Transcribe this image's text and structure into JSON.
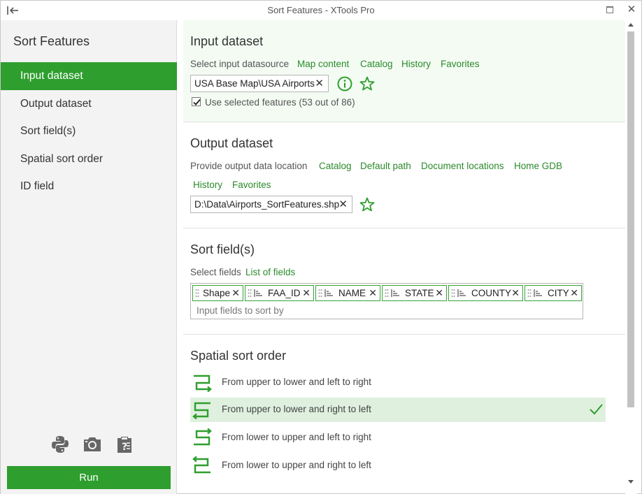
{
  "window": {
    "title": "Sort Features - XTools Pro",
    "close_glyph": "✕"
  },
  "sidebar": {
    "heading": "Sort Features",
    "items": [
      {
        "label": "Input dataset",
        "active": true
      },
      {
        "label": "Output dataset",
        "active": false
      },
      {
        "label": "Sort field(s)",
        "active": false
      },
      {
        "label": "Spatial sort order",
        "active": false
      },
      {
        "label": "ID field",
        "active": false
      }
    ],
    "tools": [
      "python-icon",
      "camera-icon",
      "help-clipboard-icon"
    ],
    "run_label": "Run"
  },
  "input_dataset": {
    "title": "Input dataset",
    "prompt": "Select input datasource",
    "links": [
      "Map content",
      "Catalog",
      "History",
      "Favorites"
    ],
    "value": "USA Base Map\\USA Airports",
    "use_selected_label": "Use selected features (53 out of 86)",
    "use_selected_checked": true
  },
  "output_dataset": {
    "title": "Output dataset",
    "prompt": "Provide output data location",
    "links": [
      "Catalog",
      "Default path",
      "Document locations",
      "Home GDB",
      "History",
      "Favorites"
    ],
    "value": "D:\\Data\\Airports_SortFeatures.shp"
  },
  "sort_fields": {
    "title": "Sort field(s)",
    "prompt": "Select fields",
    "link": "List of fields",
    "tags": [
      "Shape",
      "FAA_ID",
      "NAME",
      "STATE",
      "COUNTY",
      "CITY"
    ],
    "placeholder": "Input fields to sort by"
  },
  "spatial_sort": {
    "title": "Spatial sort order",
    "options": [
      {
        "label": "From upper to lower and left to right",
        "selected": false
      },
      {
        "label": "From upper to lower and right to left",
        "selected": true
      },
      {
        "label": "From lower to upper and left to right",
        "selected": false
      },
      {
        "label": "From lower to upper and right to left",
        "selected": false
      }
    ]
  },
  "colors": {
    "accent": "#2e9e2e",
    "link": "#2b8a2b",
    "selected_bg": "#dff0df",
    "section_bg": "#f3fbf3"
  }
}
